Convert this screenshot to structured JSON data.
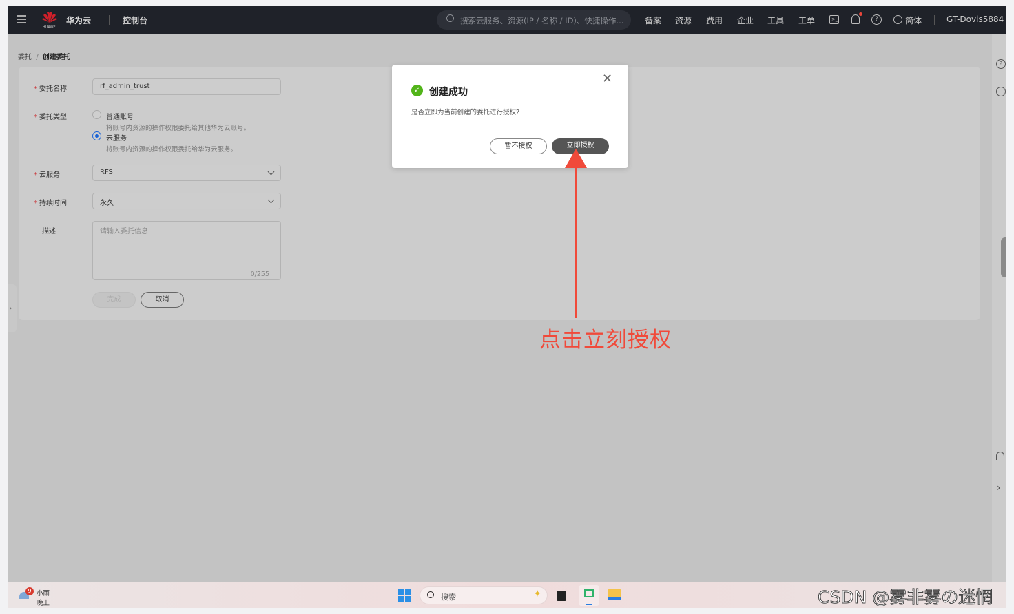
{
  "topbar": {
    "brand": "华为云",
    "brand_sub": "HUAWEI",
    "console": "控制台",
    "search_placeholder": "搜索云服务、资源(IP / 名称 / ID)、快捷操作...",
    "nav": [
      "备案",
      "资源",
      "费用",
      "企业",
      "工具",
      "工单"
    ],
    "language": "简体",
    "user": "GT-Dovis5884"
  },
  "breadcrumb": {
    "parent": "委托",
    "sep": "/",
    "current": "创建委托"
  },
  "form": {
    "name_label": "委托名称",
    "name_value": "rf_admin_trust",
    "type_label": "委托类型",
    "type_options": [
      {
        "label": "普通账号",
        "desc": "将账号内资源的操作权限委托给其他华为云账号。",
        "selected": false
      },
      {
        "label": "云服务",
        "desc": "将账号内资源的操作权限委托给华为云服务。",
        "selected": true
      }
    ],
    "service_label": "云服务",
    "service_value": "RFS",
    "duration_label": "持续时间",
    "duration_value": "永久",
    "desc_label": "描述",
    "desc_placeholder": "请输入委托信息",
    "desc_counter": "0/255",
    "finish_label": "完成",
    "cancel_label": "取消"
  },
  "modal": {
    "title": "创建成功",
    "message": "是否立即为当前创建的委托进行授权?",
    "later_label": "暂不授权",
    "now_label": "立即授权"
  },
  "annotation": {
    "text": "点击立刻授权",
    "color": "#f04a3a"
  },
  "taskbar": {
    "weather_badge": "9",
    "weather": "小雨",
    "time_of_day": "晚上",
    "search_label": "搜索"
  },
  "watermark": "CSDN @雾非雾の迷惘",
  "colors": {
    "accent": "#1a63d6",
    "success": "#52b41a",
    "primary_button": "#555555"
  }
}
